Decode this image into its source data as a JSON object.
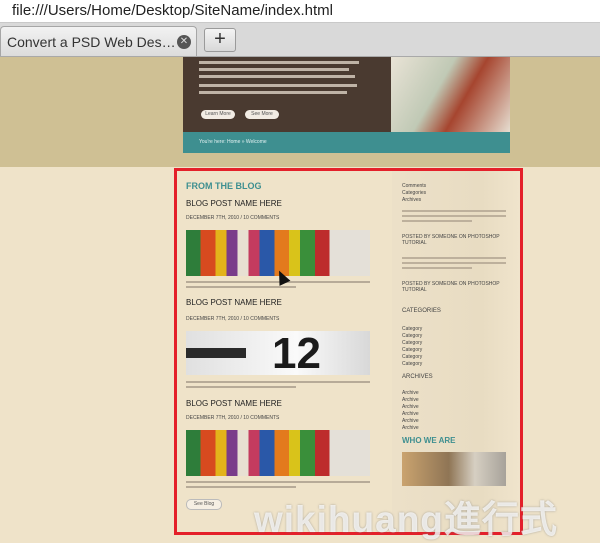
{
  "browser": {
    "address": "file:///Users/Home/Desktop/SiteName/index.html",
    "tab_title": "Convert a PSD Web Des…",
    "new_tab_label": "+",
    "tab_close": "⊗"
  },
  "hero": {
    "buttons": [
      "Learn More",
      "See More"
    ],
    "footer_text": "You're here: Home » Welcome"
  },
  "blog": {
    "section_title": "FROM THE BLOG",
    "posts": [
      {
        "title": "BLOG POST NAME HERE",
        "date": "DECEMBER 7TH, 2010 / 10 COMMENTS"
      },
      {
        "title": "BLOG POST NAME HERE",
        "date": "DECEMBER 7TH, 2010 / 10 COMMENTS"
      },
      {
        "title": "BLOG POST NAME HERE",
        "date": "DECEMBER 7TH, 2010 / 10 COMMENTS"
      }
    ],
    "clock_text": "12",
    "more_button": "See Blog"
  },
  "sidebar": {
    "top_links": [
      "Comments",
      "Categories",
      "Archives"
    ],
    "posted_by_1": "POSTED BY SOMEONE ON PHOTOSHOP TUTORIAL",
    "posted_by_2": "POSTED BY SOMEONE ON PHOTOSHOP TUTORIAL",
    "categories_title": "CATEGORIES",
    "categories": [
      "Category",
      "Category",
      "Category",
      "Category",
      "Category",
      "Category"
    ],
    "archives_title": "ARCHIVES",
    "archives": [
      "Archive",
      "Archive",
      "Archive",
      "Archive",
      "Archive",
      "Archive"
    ],
    "who_title": "WHO WE ARE"
  },
  "watermark": "wikihuang進行式",
  "colors": {
    "teal": "#3e8f90",
    "highlight_frame": "#e4202a"
  }
}
